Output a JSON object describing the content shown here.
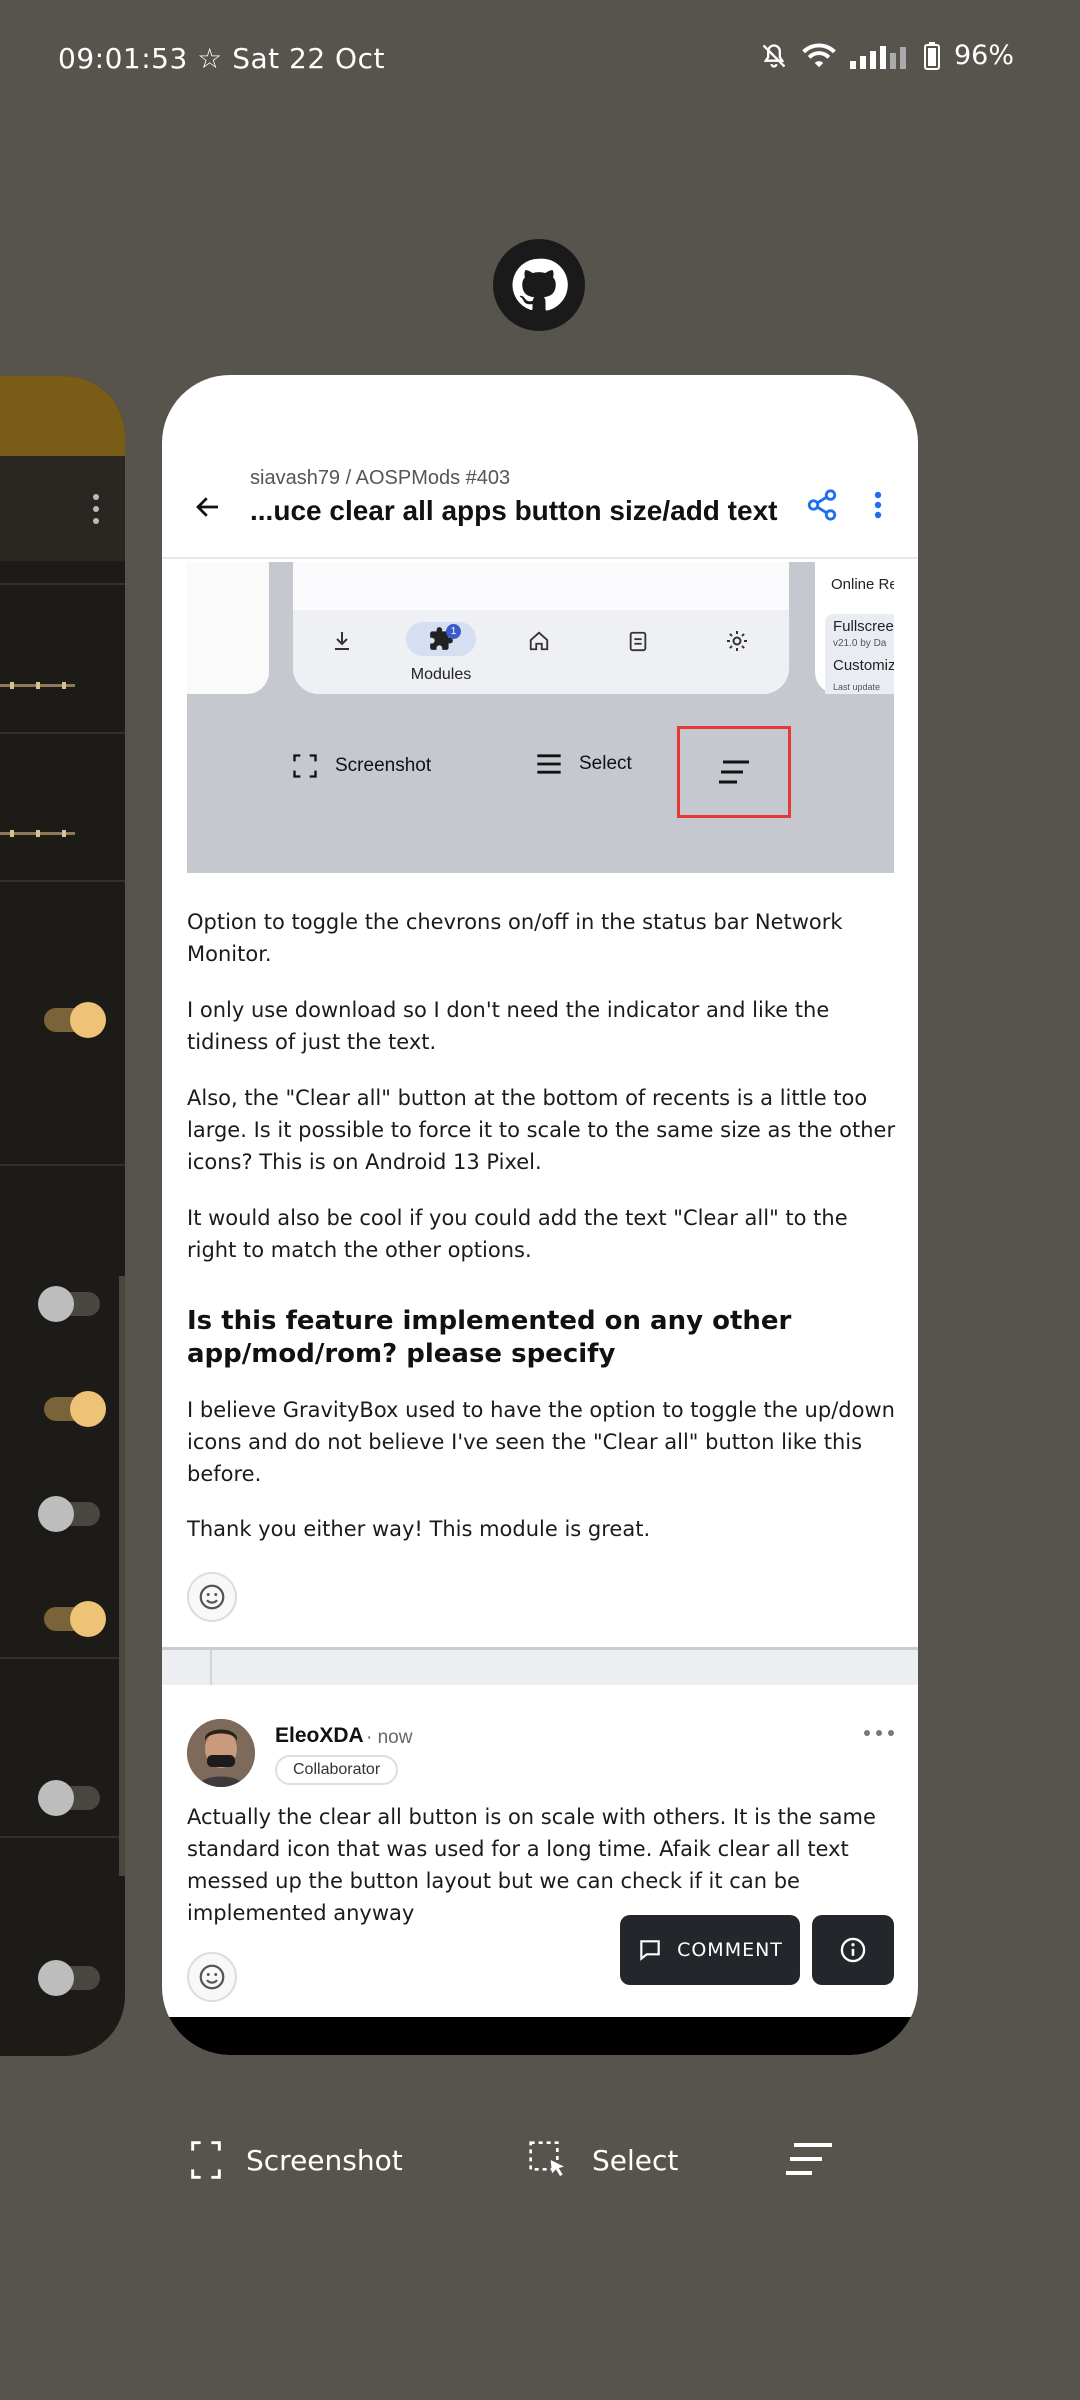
{
  "status_bar": {
    "time": "09:01:53",
    "date": "Sat 22 Oct",
    "battery": "96%"
  },
  "app_bar": {
    "repo": "siavash79 / AOSPMods #403",
    "title": "...uce clear all apps button size/add text"
  },
  "embedded_image": {
    "nav_modules_label": "Modules",
    "badge": "1",
    "next_card_title": "Online Re",
    "next_card_line1": "Fullscree",
    "next_card_line2": "v21.0 by Da",
    "next_card_line3": "Customiz",
    "next_card_line4": "Last update",
    "screenshot_label": "Screenshot",
    "select_label": "Select"
  },
  "issue_body": {
    "p1": "Option to toggle the chevrons on/off in the status bar Network Monitor.",
    "p2": "I only use download so I don't need the indicator and like the tidiness of just the text.",
    "p3": "Also, the \"Clear all\" button at the bottom of recents is a little too large. Is it possible to force it to scale to the same size as the other icons? This is on Android 13 Pixel.",
    "p4": "It would also be cool if you could add the text \"Clear all\" to the right to match the other options.",
    "heading": "Is this feature implemented on any other app/mod/rom? please specify",
    "p5": "I believe GravityBox used to have the option to toggle the up/down icons and do not believe I've seen the \"Clear all\" button like this before.",
    "p6": "Thank you either way! This module is great."
  },
  "comment": {
    "author": "EleoXDA",
    "time": "· now",
    "role": "Collaborator",
    "text": "Actually the clear all button is on scale with others. It is the same standard icon that was used for a long time. Afaik clear all text messed up the button layout but we can check if it can be implemented anyway"
  },
  "fab": {
    "comment_label": "COMMENT"
  },
  "recents_actions": {
    "screenshot_label": "Screenshot",
    "select_label": "Select"
  },
  "colors": {
    "background": "#57544d",
    "accent_blue": "#1f6feb",
    "fab_dark": "#23272b",
    "highlight_red": "#e53935",
    "toggle_on": "#eec377"
  }
}
